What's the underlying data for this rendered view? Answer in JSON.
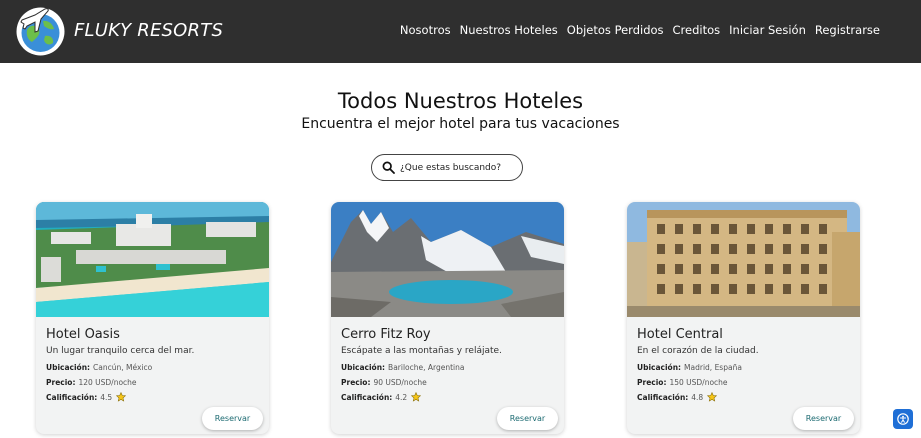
{
  "brand": {
    "name": "FLUKY RESORTS",
    "logo_icon": "globe-airplane-logo-icon"
  },
  "nav": {
    "items": [
      {
        "label": "Nosotros"
      },
      {
        "label": "Nuestros Hoteles"
      },
      {
        "label": "Objetos Perdidos"
      },
      {
        "label": "Creditos"
      },
      {
        "label": "Iniciar Sesión"
      },
      {
        "label": "Registrarse"
      }
    ]
  },
  "hero": {
    "title": "Todos Nuestros Hoteles",
    "subtitle": "Encuentra el mejor hotel para tus vacaciones"
  },
  "search": {
    "placeholder": "¿Que estas buscando?",
    "icon": "search-icon"
  },
  "labels": {
    "location": "Ubicación:",
    "price": "Precio:",
    "rating": "Calificación:",
    "reserve": "Reservar"
  },
  "hotels": [
    {
      "name": "Hotel Oasis",
      "description": "Un lugar tranquilo cerca del mar.",
      "location": "Cancún, México",
      "price": "120 USD/noche",
      "rating": "4.5",
      "image": "beach-resort-image"
    },
    {
      "name": "Cerro Fitz Roy",
      "description": "Escápate a las montañas y relájate.",
      "location": "Bariloche, Argentina",
      "price": "90 USD/noche",
      "rating": "4.2",
      "image": "mountain-lake-image"
    },
    {
      "name": "Hotel Central",
      "description": "En el corazón de la ciudad.",
      "location": "Madrid, España",
      "price": "150 USD/noche",
      "rating": "4.8",
      "image": "city-building-image"
    }
  ],
  "colors": {
    "navbar": "#2f2f2f",
    "card_bg": "#f2f3f3",
    "reserve_text": "#1d6b72",
    "accessibility_button": "#1f6fd6"
  }
}
